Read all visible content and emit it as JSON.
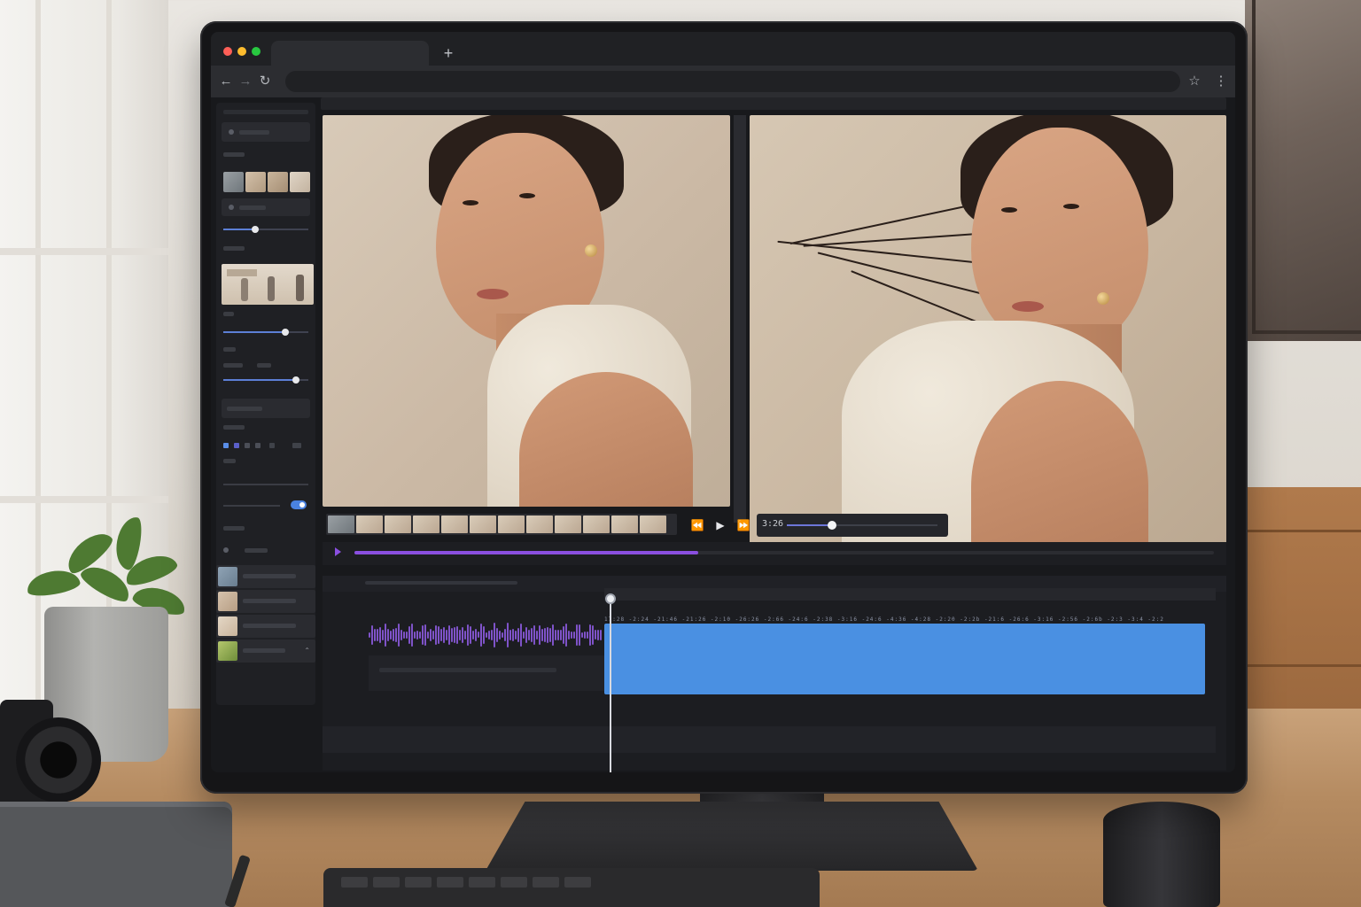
{
  "browser": {
    "new_tab_glyph": "+",
    "back_icon": "arrow-left-icon",
    "forward_icon": "arrow-right-icon",
    "reload_icon": "reload-icon",
    "bookmark_icon": "star-icon",
    "menu_icon": "kebab-menu-icon",
    "traffic_lights": [
      "#ff5f57",
      "#febc2e",
      "#28c840"
    ]
  },
  "editor": {
    "controls": {
      "rewind_glyph": "⏪",
      "play_glyph": "▶",
      "forward_glyph": "⏩"
    },
    "scrubber": {
      "timecode": "3:26",
      "position": 0.3
    },
    "playback_progress": 0.4,
    "timeline": {
      "clip_ticks": "17:28  -2:24 -21:46 -21:26 -2:10 -26:26 -2:66 -24:6 -2:38 -3:16 -24:6 -4:36 -4:28 -2:20 -2:2b -21:6 -26:6 -3:16 -2:56 -2:6b -2:3 -3:4 -2:2"
    },
    "colors": {
      "accent_purple": "#8a4fe0",
      "clip_blue": "#4a90e2",
      "toggle_blue": "#4a82e0"
    }
  }
}
